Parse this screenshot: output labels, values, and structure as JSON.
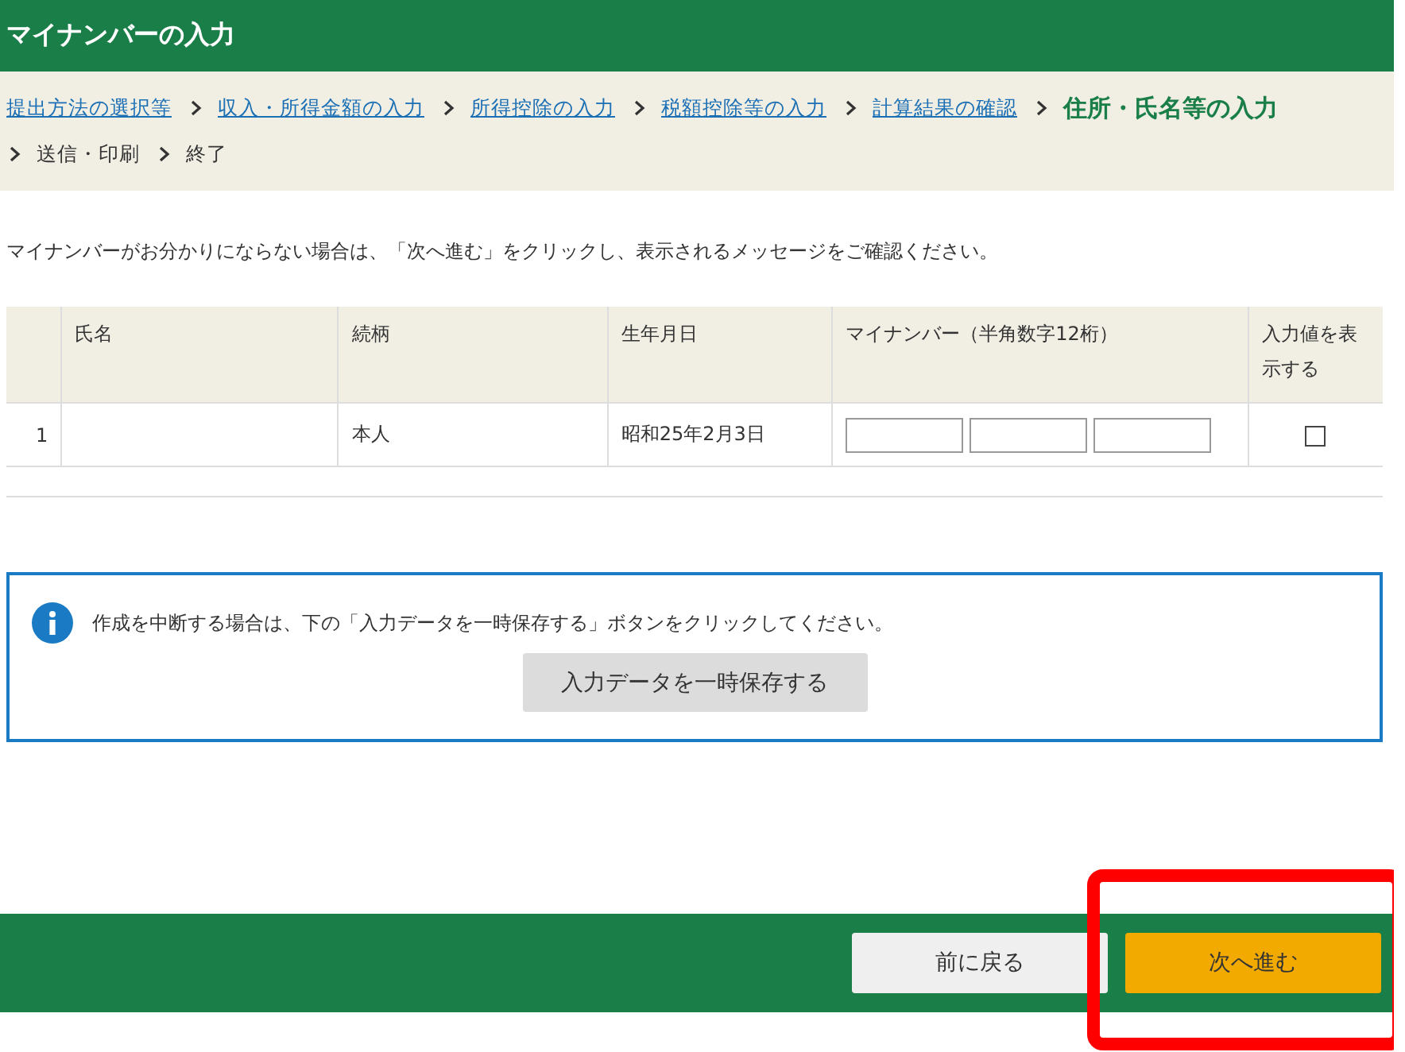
{
  "header": {
    "title": "マイナンバーの入力"
  },
  "breadcrumb": [
    {
      "label": "提出方法の選択等",
      "kind": "link"
    },
    {
      "label": "収入・所得金額の入力",
      "kind": "link"
    },
    {
      "label": "所得控除の入力",
      "kind": "link"
    },
    {
      "label": "税額控除等の入力",
      "kind": "link"
    },
    {
      "label": "計算結果の確認",
      "kind": "link"
    },
    {
      "label": "住所・氏名等の入力",
      "kind": "current"
    },
    {
      "label": "送信・印刷",
      "kind": "plain"
    },
    {
      "label": "終了",
      "kind": "plain"
    }
  ],
  "message": "マイナンバーがお分かりにならない場合は、「次へ進む」をクリックし、表示されるメッセージをご確認ください。",
  "table": {
    "columns": [
      "氏名",
      "続柄",
      "生年月日",
      "マイナンバー（半角数字12桁）",
      "入力値を表示する"
    ],
    "rows": [
      {
        "number": "1",
        "relation": "本人",
        "birthdate": "昭和25年2月3日",
        "show_value": false
      }
    ]
  },
  "notice": {
    "text": "作成を中断する場合は、下の「入力データを一時保存する」ボタンをクリックしてください。",
    "button": "入力データを一時保存する"
  },
  "footer_buttons": [
    {
      "label": "前に戻る",
      "kind": "secondary",
      "highlighted": false
    },
    {
      "label": "次へ進む",
      "kind": "primary",
      "highlighted": true
    }
  ]
}
